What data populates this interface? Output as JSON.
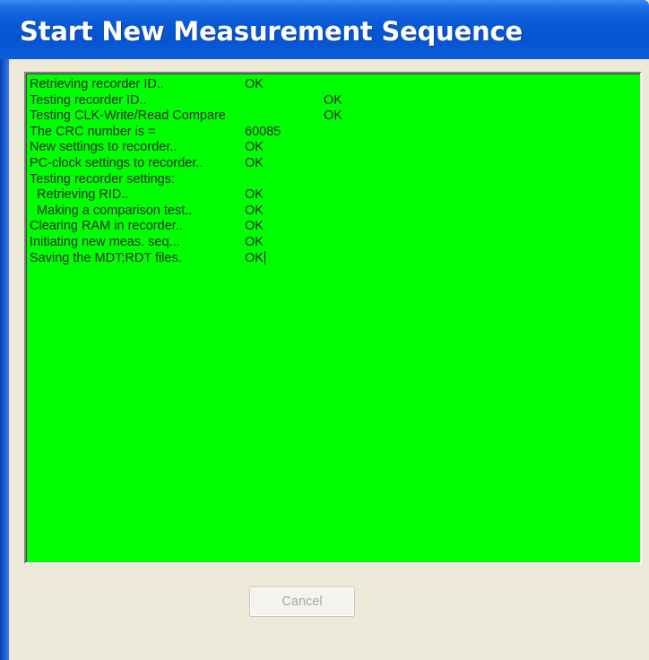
{
  "window": {
    "title": "Start New Measurement Sequence"
  },
  "log": {
    "lines": [
      {
        "label": "Retrieving recorder ID..",
        "value": "OK"
      },
      {
        "label": "Testing recorder ID..",
        "value": "OK"
      },
      {
        "label": "Testing CLK-Write/Read Compare",
        "value": "OK"
      },
      {
        "label": "The CRC number is =",
        "value": "60085"
      },
      {
        "label": "New settings to recorder..",
        "value": "OK"
      },
      {
        "label": "PC-clock settings to recorder..",
        "value": "OK"
      },
      {
        "label": "Testing recorder settings:",
        "value": ""
      },
      {
        "label": "  Retrieving RID..",
        "value": "OK"
      },
      {
        "label": "  Making a comparison test..",
        "value": "OK"
      },
      {
        "label": "Clearing RAM in recorder..",
        "value": "OK"
      },
      {
        "label": "Initiating new meas. seq...",
        "value": "OK"
      },
      {
        "label": "Saving the MDT;RDT files.",
        "value": "OK"
      }
    ],
    "background_color": "#00ff00"
  },
  "buttons": {
    "cancel_label": "Cancel",
    "cancel_enabled": false
  }
}
